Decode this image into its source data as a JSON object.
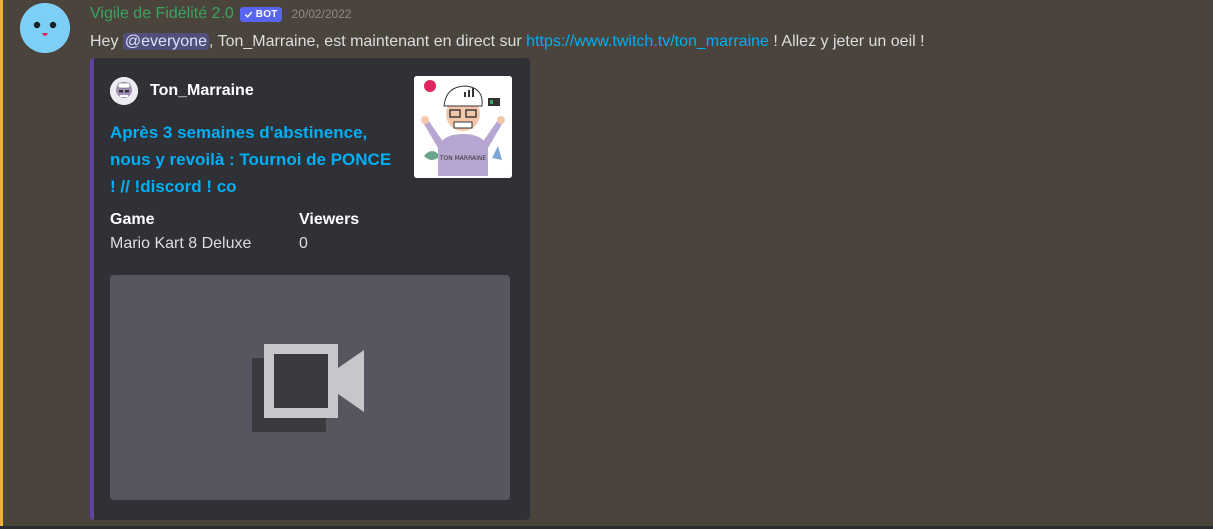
{
  "author": {
    "name": "Vigile de Fidélité 2.0",
    "bot_tag": "BOT",
    "timestamp": "20/02/2022"
  },
  "message": {
    "prefix": "Hey ",
    "mention": "@everyone",
    "middle": ", Ton_Marraine, est maintenant en direct sur ",
    "link": "https://www.twitch.tv/ton_marraine",
    "suffix": " ! Allez y jeter un oeil !"
  },
  "embed": {
    "author_name": "Ton_Marraine",
    "title": "Après 3 semaines d'abstinence, nous y revoilà : Tournoi de PONCE ! // !discord ! co",
    "accent_color": "#6441a5",
    "fields": [
      {
        "name": "Game",
        "value": "Mario Kart 8 Deluxe"
      },
      {
        "name": "Viewers",
        "value": "0"
      }
    ],
    "thumbnail_text": "TON MARRAINE",
    "video_icon": "video-camera-icon"
  },
  "colors": {
    "username": "#3ba55d",
    "link": "#00aff4",
    "bot_badge": "#5865f2",
    "highlight": "#f0b232"
  }
}
